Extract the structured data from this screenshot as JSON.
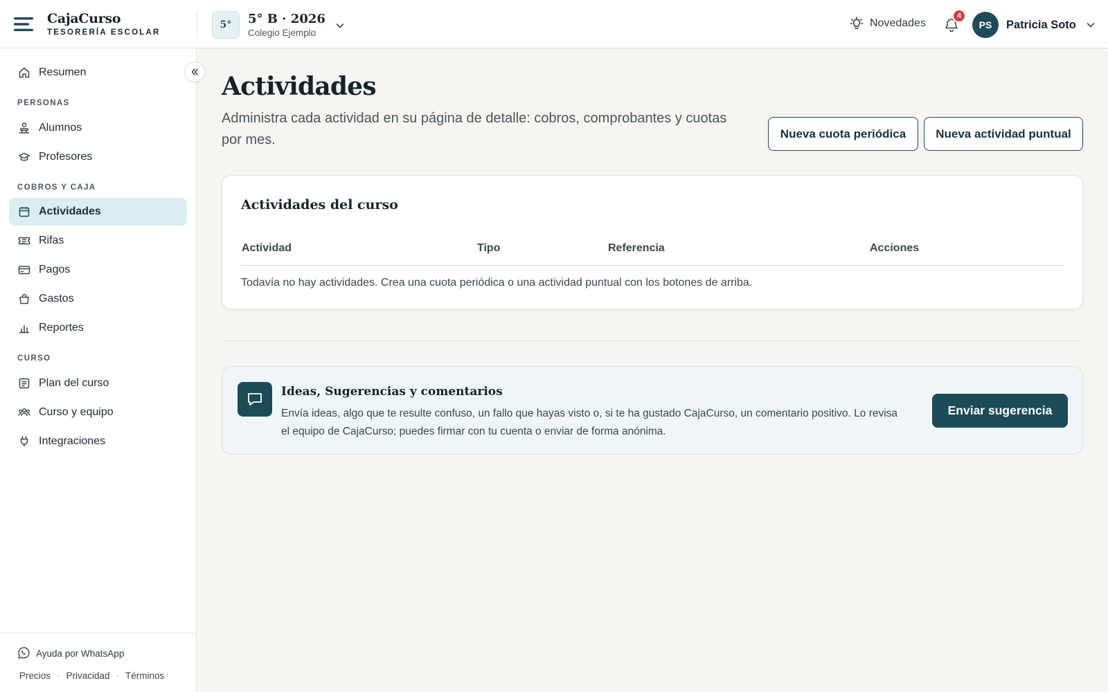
{
  "brand": {
    "name": "CajaCurso",
    "subtitle": "TESORERÍA ESCOLAR"
  },
  "course": {
    "badge": "5°",
    "name": "5° B · 2026",
    "school": "Colegio Ejemplo"
  },
  "header": {
    "news_label": "Novedades",
    "notifications_count": "4",
    "user_initials": "PS",
    "user_name": "Patricia Soto"
  },
  "sidebar": {
    "summary": "Resumen",
    "sections": {
      "people": "PERSONAS",
      "cash": "COBROS Y CAJA",
      "course": "CURSO"
    },
    "items": {
      "students": "Alumnos",
      "teachers": "Profesores",
      "activities": "Actividades",
      "raffles": "Rifas",
      "payments": "Pagos",
      "expenses": "Gastos",
      "reports": "Reportes",
      "course_plan": "Plan del curso",
      "course_team": "Curso y equipo",
      "integrations": "Integraciones"
    },
    "active_item": "Actividades",
    "help": "Ayuda por WhatsApp",
    "footer_links": [
      "Precios",
      "Privacidad",
      "Términos"
    ]
  },
  "main": {
    "title": "Actividades",
    "description": "Administra cada actividad en su página de detalle: cobros, comprobantes y cuotas por mes.",
    "buttons": {
      "new_periodic": "Nueva cuota periódica",
      "new_oneoff": "Nueva actividad puntual"
    },
    "table": {
      "title": "Actividades del curso",
      "columns": [
        "Actividad",
        "Tipo",
        "Referencia",
        "Acciones"
      ],
      "rows": [],
      "empty_message": "Todavía no hay actividades. Crea una cuota periódica o una actividad puntual con los botones de arriba."
    },
    "feedback": {
      "title": "Ideas, Sugerencias y comentarios",
      "text": "Envía ideas, algo que te resulte confuso, un fallo que hayas visto o, si te ha gustado CajaCurso, un comentario positivo. Lo revisa el equipo de CajaCurso; puedes firmar con tu cuenta o enviar de forma anónima.",
      "button": "Enviar sugerencia"
    }
  },
  "colors": {
    "accent": "#1d4b58",
    "active_bg": "#dcedf1",
    "badge": "#e0393e",
    "page_bg": "#f6f5f2"
  },
  "icons": {
    "menu": "menu-icon",
    "chevron": "chevron-down-icon",
    "news": "lightbulb-icon",
    "bell": "bell-icon",
    "collapse": "double-chevron-left-icon",
    "summary": "home-icon",
    "students": "student-icon",
    "teachers": "graduation-cap-icon",
    "activities": "calendar-icon",
    "raffles": "ticket-icon",
    "payments": "credit-card-icon",
    "expenses": "shopping-bag-icon",
    "reports": "bar-chart-icon",
    "course_plan": "document-icon",
    "course_team": "team-icon",
    "integrations": "plug-icon",
    "help": "whatsapp-icon",
    "feedback": "chat-bubble-icon"
  }
}
